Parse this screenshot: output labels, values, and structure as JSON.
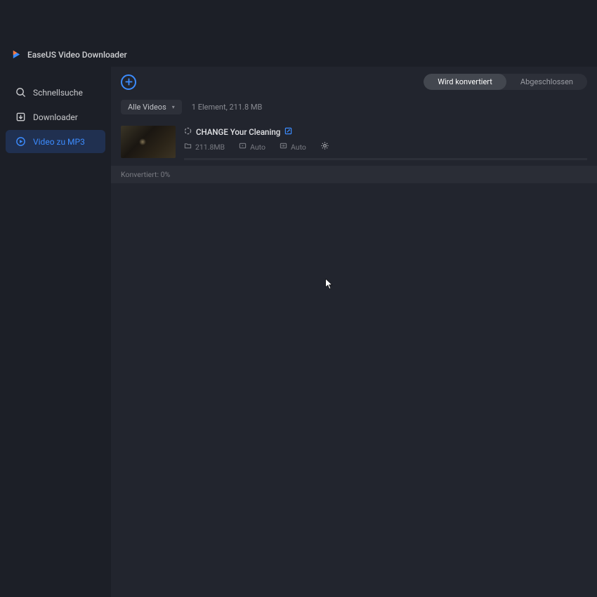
{
  "app": {
    "title": "EaseUS Video Downloader"
  },
  "sidebar": {
    "items": [
      {
        "label": "Schnellsuche"
      },
      {
        "label": "Downloader"
      },
      {
        "label": "Video zu MP3"
      }
    ]
  },
  "tabs": {
    "converting": "Wird konvertiert",
    "completed": "Abgeschlossen"
  },
  "filter": {
    "label": "Alle Videos",
    "count_text": "1 Element, 211.8 MB"
  },
  "item": {
    "title": "CHANGE Your Cleaning",
    "size": "211.8MB",
    "video_quality": "Auto",
    "audio_quality": "Auto",
    "status": "Konvertiert: 0%"
  },
  "icons": {
    "plus": "+",
    "tri": "▾"
  }
}
